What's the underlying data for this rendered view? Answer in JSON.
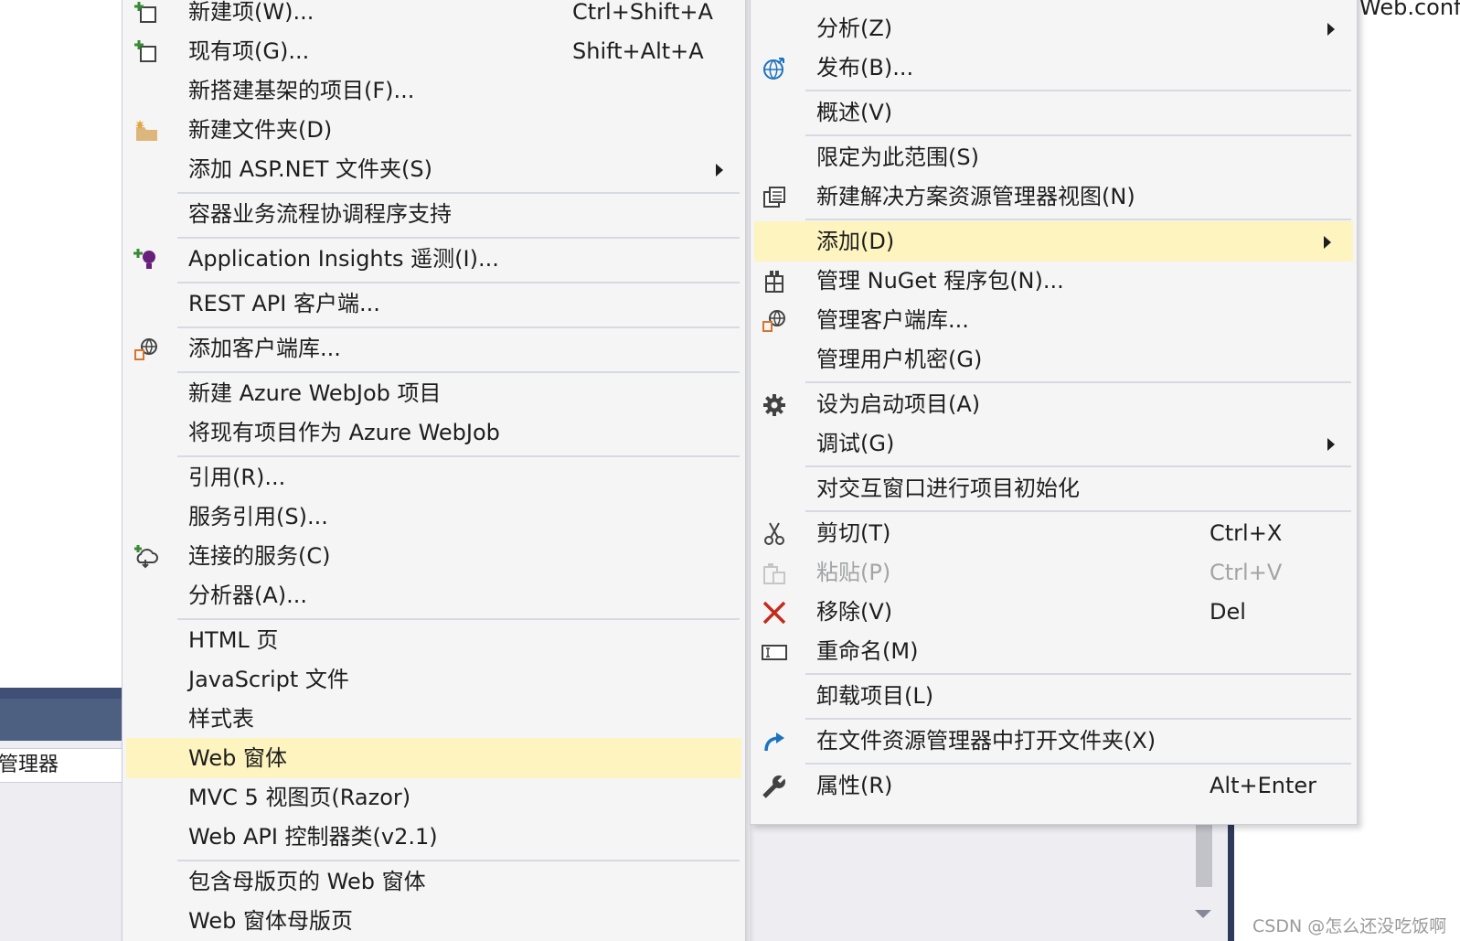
{
  "background": {
    "left_tab_label": "管理器",
    "right_file_label": "Web.conf",
    "watermark": "CSDN @怎么还没吃饭啊"
  },
  "left_menu": {
    "items": [
      {
        "label": "新建项(W)...",
        "shortcut": "Ctrl+Shift+A",
        "icon": "new-item-icon"
      },
      {
        "label": "现有项(G)...",
        "shortcut": "Shift+Alt+A",
        "icon": "existing-item-icon"
      },
      {
        "label": "新搭建基架的项目(F)..."
      },
      {
        "label": "新建文件夹(D)",
        "icon": "new-folder-icon"
      },
      {
        "label": "添加 ASP.NET 文件夹(S)",
        "submenu": true
      },
      {
        "label": "容器业务流程协调程序支持"
      },
      {
        "label": "Application Insights 遥测(I)...",
        "icon": "application-insights-icon"
      },
      {
        "label": "REST API 客户端..."
      },
      {
        "label": "添加客户端库...",
        "icon": "client-library-icon"
      },
      {
        "label": "新建 Azure WebJob 项目"
      },
      {
        "label": "将现有项目作为 Azure WebJob"
      },
      {
        "label": "引用(R)..."
      },
      {
        "label": "服务引用(S)..."
      },
      {
        "label": "连接的服务(C)",
        "icon": "connected-service-icon"
      },
      {
        "label": "分析器(A)..."
      },
      {
        "label": "HTML 页"
      },
      {
        "label": "JavaScript 文件"
      },
      {
        "label": "样式表"
      },
      {
        "label": "Web 窗体",
        "highlighted": true
      },
      {
        "label": "MVC 5 视图页(Razor)"
      },
      {
        "label": "Web API 控制器类(v2.1)"
      },
      {
        "label": "包含母版页的 Web 窗体"
      },
      {
        "label": "Web 窗体母版页"
      }
    ]
  },
  "right_menu": {
    "items": [
      {
        "label": "分析(Z)",
        "submenu": true
      },
      {
        "label": "发布(B)...",
        "icon": "publish-globe-icon"
      },
      {
        "label": "概述(V)"
      },
      {
        "label": "限定为此范围(S)"
      },
      {
        "label": "新建解决方案资源管理器视图(N)",
        "icon": "new-explorer-view-icon"
      },
      {
        "label": "添加(D)",
        "submenu": true,
        "highlighted": true
      },
      {
        "label": "管理 NuGet 程序包(N)...",
        "icon": "nuget-icon"
      },
      {
        "label": "管理客户端库...",
        "icon": "client-library-icon"
      },
      {
        "label": "管理用户机密(G)"
      },
      {
        "label": "设为启动项目(A)",
        "icon": "gear-icon"
      },
      {
        "label": "调试(G)",
        "submenu": true
      },
      {
        "label": "对交互窗口进行项目初始化"
      },
      {
        "label": "剪切(T)",
        "shortcut": "Ctrl+X",
        "icon": "scissors-icon"
      },
      {
        "label": "粘贴(P)",
        "shortcut": "Ctrl+V",
        "icon": "paste-icon",
        "disabled": true
      },
      {
        "label": "移除(V)",
        "shortcut": "Del",
        "icon": "remove-x-icon"
      },
      {
        "label": "重命名(M)",
        "icon": "rename-icon"
      },
      {
        "label": "卸载项目(L)"
      },
      {
        "label": "在文件资源管理器中打开文件夹(X)",
        "icon": "open-folder-arrow-icon"
      },
      {
        "label": "属性(R)",
        "shortcut": "Alt+Enter",
        "icon": "wrench-icon"
      }
    ]
  },
  "colors": {
    "menu_background": "#f5f5f5",
    "highlight": "#fdf4bf",
    "separator": "#d8dae3",
    "remove_red": "#c42b1c",
    "link_blue": "#1e73be"
  }
}
